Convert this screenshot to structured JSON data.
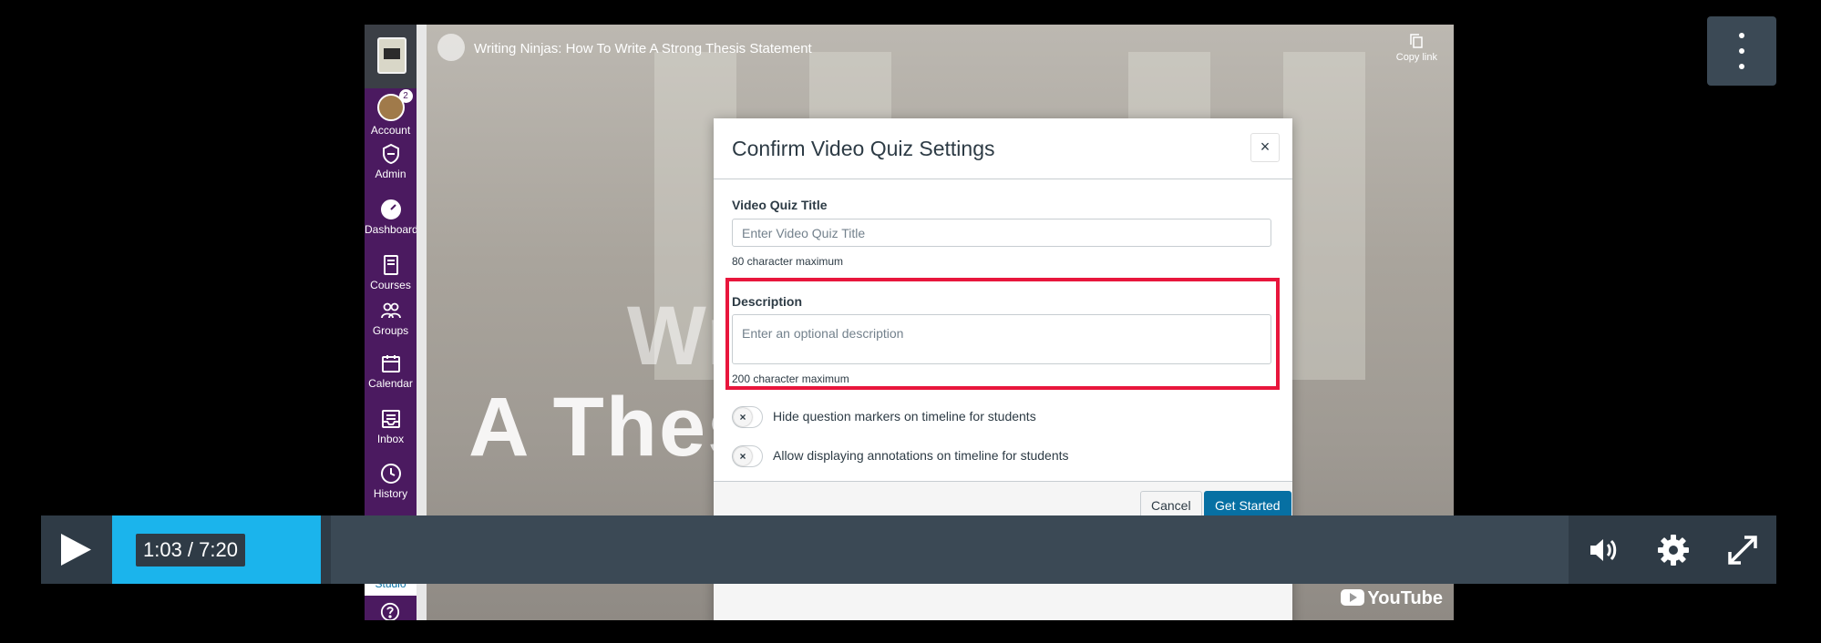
{
  "video": {
    "title": "Writing Ninjas: How To Write A Strong Thesis Statement",
    "copy_link": "Copy link",
    "overlay_text_line1": "Write",
    "overlay_text_line2": "A Thesis Statement",
    "youtube_label": "YouTube"
  },
  "nav": {
    "account_badge": "2",
    "items": [
      {
        "label": "Account",
        "icon": "account-avatar"
      },
      {
        "label": "Admin",
        "icon": "shield-icon"
      },
      {
        "label": "Dashboard",
        "icon": "speedometer-icon"
      },
      {
        "label": "Courses",
        "icon": "book-icon"
      },
      {
        "label": "Groups",
        "icon": "people-icon"
      },
      {
        "label": "Calendar",
        "icon": "calendar-icon"
      },
      {
        "label": "Inbox",
        "icon": "inbox-icon"
      },
      {
        "label": "History",
        "icon": "clock-icon"
      }
    ],
    "studio_label": "Studio"
  },
  "modal": {
    "title": "Confirm Video Quiz Settings",
    "close": "×",
    "quiz_title_label": "Video Quiz Title",
    "quiz_title_placeholder": "Enter Video Quiz Title",
    "quiz_title_hint": "80 character maximum",
    "description_label": "Description",
    "description_placeholder": "Enter an optional description",
    "description_hint": "200 character maximum",
    "toggle_hide_markers": "Hide question markers on timeline for students",
    "toggle_annotations": "Allow displaying annotations on timeline for students",
    "toggle_off_symbol": "×",
    "cancel_label": "Cancel",
    "start_label": "Get Started",
    "highlight_color": "#e8163c",
    "primary_color": "#0770a3"
  },
  "player": {
    "time": "1:03 / 7:20",
    "progress_fraction": 0.143,
    "accent_color": "#1bb4ec"
  }
}
